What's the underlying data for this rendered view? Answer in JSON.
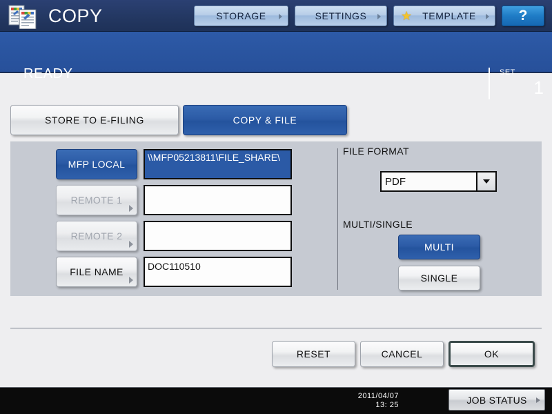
{
  "header": {
    "app_title": "COPY",
    "icon": "copy-documents-icon",
    "buttons": [
      {
        "id": "storage",
        "label": "STORAGE",
        "icon": "chevron-right-icon"
      },
      {
        "id": "settings",
        "label": "SETTINGS",
        "icon": "chevron-right-icon"
      },
      {
        "id": "template",
        "label": "TEMPLATE",
        "icon": "star-icon"
      }
    ],
    "help_label": "?"
  },
  "status": {
    "message": "READY",
    "set_label": "SET",
    "set_value": "1"
  },
  "tabs": [
    {
      "id": "store-to-efiling",
      "label": "STORE TO E-FILING",
      "selected": false
    },
    {
      "id": "copy-and-file",
      "label": "COPY & FILE",
      "selected": true
    }
  ],
  "destination": {
    "rows": [
      {
        "id": "mfp-local",
        "button_label": "MFP LOCAL",
        "state": "selected",
        "value": "\\\\MFP05213811\\FILE_SHARE\\"
      },
      {
        "id": "remote-1",
        "button_label": "REMOTE 1",
        "state": "disabled",
        "value": ""
      },
      {
        "id": "remote-2",
        "button_label": "REMOTE 2",
        "state": "disabled",
        "value": ""
      },
      {
        "id": "file-name",
        "button_label": "FILE NAME",
        "state": "enabled",
        "value": "DOC110510"
      }
    ]
  },
  "file_format": {
    "label": "FILE FORMAT",
    "selected": "PDF",
    "dropdown_icon": "chevron-down-icon"
  },
  "multi_single": {
    "label": "MULTI/SINGLE",
    "multi_label": "MULTI",
    "single_label": "SINGLE",
    "selected": "MULTI"
  },
  "actions": {
    "reset_label": "RESET",
    "cancel_label": "CANCEL",
    "ok_label": "OK"
  },
  "footer": {
    "date": "2011/04/07",
    "time": "13: 25",
    "job_status_label": "JOB STATUS",
    "job_status_icon": "chevron-right-icon"
  },
  "colors": {
    "header_blue": "#233761",
    "status_blue": "#2a55a0",
    "accent_blue": "#2c5ba6",
    "panel_gray": "#c6cad2",
    "page_gray": "#eeeef0",
    "footer_black": "#0b0b0b",
    "help_blue": "#1f7cc6",
    "star_yellow": "#f3c32c"
  }
}
